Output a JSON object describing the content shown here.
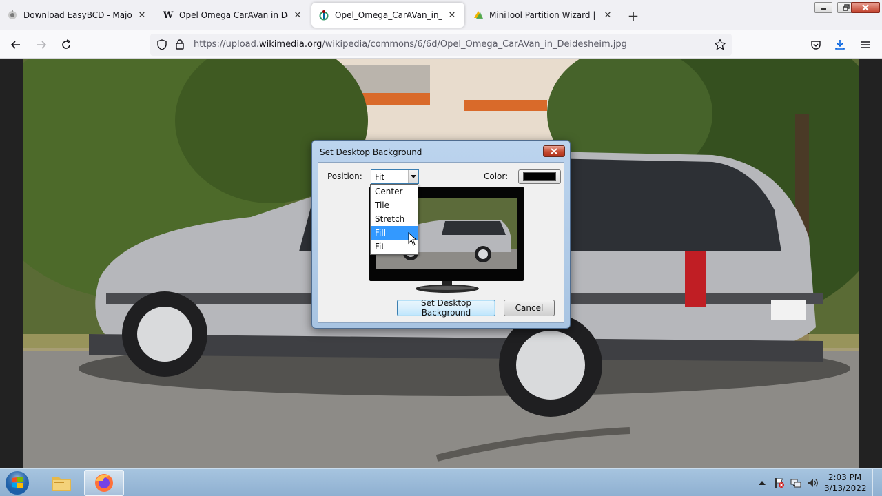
{
  "browser": {
    "tabs": [
      {
        "title": "Download EasyBCD - MajorGeeks",
        "icon": "easybcd-favicon",
        "active": false
      },
      {
        "title": "Opel Omega CarAVan in Deidesheim",
        "icon": "wikipedia-favicon",
        "active": false
      },
      {
        "title": "Opel_Omega_CarAVan_in_Deidesheim.jpg",
        "icon": "wikimedia-favicon",
        "active": true
      },
      {
        "title": "MiniTool Partition Wizard | Best",
        "icon": "minitool-favicon",
        "active": false
      }
    ],
    "wiki_glyph": "W",
    "url": {
      "prefix": "https://upload.",
      "host": "wikimedia.org",
      "path": "/wikipedia/commons/6/6d/Opel_Omega_CarAVan_in_Deidesheim.jpg"
    }
  },
  "dialog": {
    "title": "Set Desktop Background",
    "position_label": "Position:",
    "position_value": "Fit",
    "color_label": "Color:",
    "color_value": "#000000",
    "options": [
      "Center",
      "Tile",
      "Stretch",
      "Fill",
      "Fit"
    ],
    "highlighted_option": "Fill",
    "set_button": "Set Desktop Background",
    "cancel_button": "Cancel"
  },
  "taskbar": {
    "time": "2:03 PM",
    "date": "3/13/2022"
  },
  "colors": {
    "accent": "#3399ff",
    "tab_active_bg": "#ffffff",
    "taskbar": "#9dbcd9"
  }
}
